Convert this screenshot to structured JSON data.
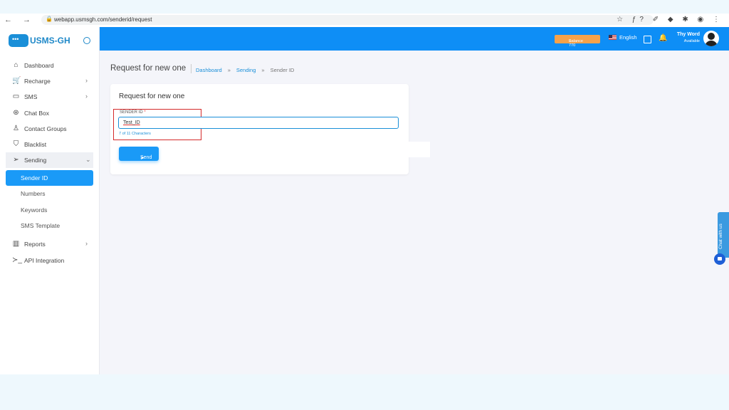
{
  "browser": {
    "nav": "← → C",
    "url": "webapp.usmsgh.com/senderid/request",
    "extensions": "☆ ƒ? ✐ ◆ ✱ ◉ ⋮"
  },
  "logo": {
    "text": "USMS-GH"
  },
  "sidebar": {
    "items": [
      {
        "label": "Dashboard",
        "icon": "⌂"
      },
      {
        "label": "Recharge",
        "icon": "🛒",
        "chevron": "›"
      },
      {
        "label": "SMS",
        "icon": "▭",
        "chevron": "›"
      },
      {
        "label": "Chat Box",
        "icon": "⊛"
      },
      {
        "label": "Contact Groups",
        "icon": "♙"
      },
      {
        "label": "Blacklist",
        "icon": "⛉"
      },
      {
        "label": "Sending",
        "icon": "➢",
        "chevron": "⌄"
      },
      {
        "label": "Reports",
        "icon": "▥",
        "chevron": "›"
      },
      {
        "label": "API Integration",
        "icon": "≻_"
      }
    ],
    "sending_sub": [
      {
        "label": "Sender ID"
      },
      {
        "label": "Numbers"
      },
      {
        "label": "Keywords"
      },
      {
        "label": "SMS Template"
      }
    ]
  },
  "topbar": {
    "balance": "Balance 770",
    "balance_chevron": "⌄",
    "language": "English",
    "user_name": "Thy Word",
    "user_status": "Available"
  },
  "header": {
    "title": "Request for new one",
    "breadcrumb": [
      "Dashboard",
      "Sending",
      "Sender ID"
    ],
    "sep": "»"
  },
  "form": {
    "title": "Request for new one",
    "label": "SENDER ID",
    "required": "*",
    "value": "Test_ID",
    "char_count": "7 of 11 Characters",
    "send_label": "Send",
    "send_icon": "➤"
  },
  "chat": {
    "tab_label": "Chat with us"
  },
  "colors": {
    "primary": "#0e8ef6",
    "balance": "#f6a24a",
    "highlight": "#d42a2a"
  }
}
